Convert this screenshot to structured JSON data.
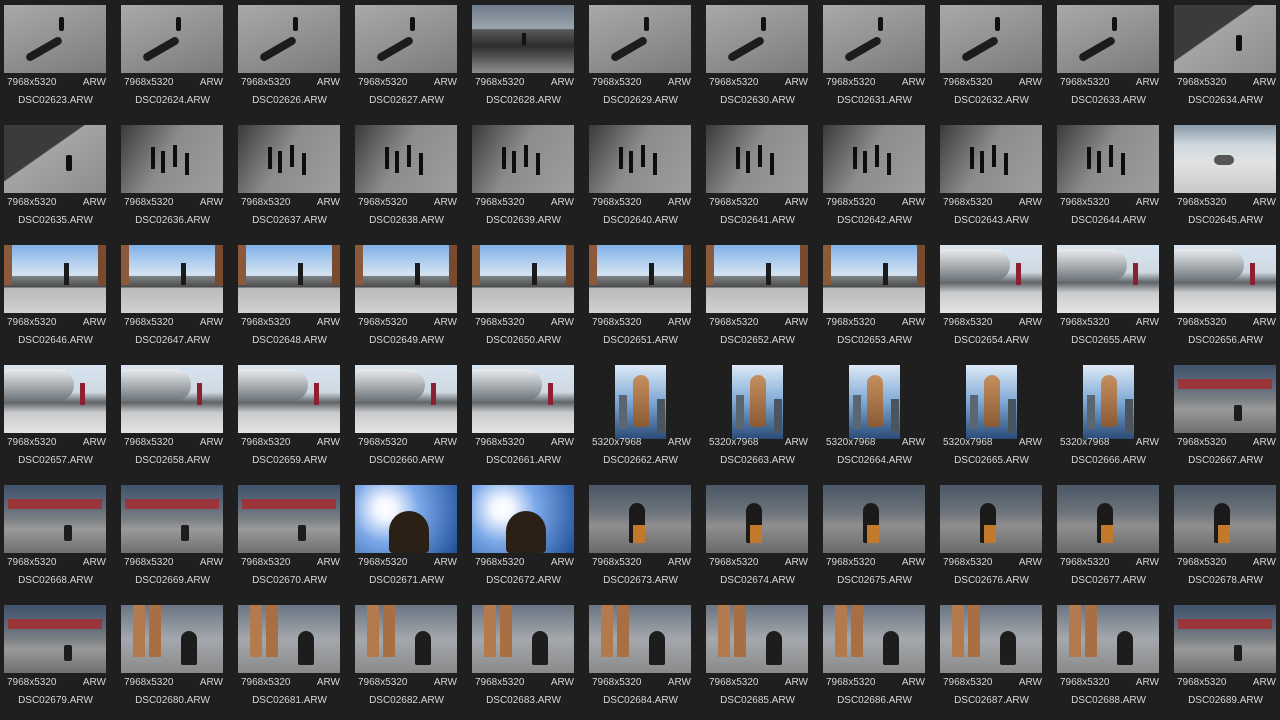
{
  "gallery": {
    "columns": 11,
    "items": [
      {
        "dims": "7968x5320",
        "format": "ARW",
        "name": "DSC02623.ARW",
        "scene": "shadow",
        "orientation": "landscape"
      },
      {
        "dims": "7968x5320",
        "format": "ARW",
        "name": "DSC02624.ARW",
        "scene": "shadow",
        "orientation": "landscape"
      },
      {
        "dims": "7968x5320",
        "format": "ARW",
        "name": "DSC02626.ARW",
        "scene": "shadow",
        "orientation": "landscape"
      },
      {
        "dims": "7968x5320",
        "format": "ARW",
        "name": "DSC02627.ARW",
        "scene": "shadow",
        "orientation": "landscape"
      },
      {
        "dims": "7968x5320",
        "format": "ARW",
        "name": "DSC02628.ARW",
        "scene": "plaza",
        "orientation": "landscape"
      },
      {
        "dims": "7968x5320",
        "format": "ARW",
        "name": "DSC02629.ARW",
        "scene": "shadow",
        "orientation": "landscape"
      },
      {
        "dims": "7968x5320",
        "format": "ARW",
        "name": "DSC02630.ARW",
        "scene": "shadow",
        "orientation": "landscape"
      },
      {
        "dims": "7968x5320",
        "format": "ARW",
        "name": "DSC02631.ARW",
        "scene": "shadow",
        "orientation": "landscape"
      },
      {
        "dims": "7968x5320",
        "format": "ARW",
        "name": "DSC02632.ARW",
        "scene": "shadow",
        "orientation": "landscape"
      },
      {
        "dims": "7968x5320",
        "format": "ARW",
        "name": "DSC02633.ARW",
        "scene": "shadow",
        "orientation": "landscape"
      },
      {
        "dims": "7968x5320",
        "format": "ARW",
        "name": "DSC02634.ARW",
        "scene": "diag",
        "orientation": "landscape"
      },
      {
        "dims": "7968x5320",
        "format": "ARW",
        "name": "DSC02635.ARW",
        "scene": "diag",
        "orientation": "landscape"
      },
      {
        "dims": "7968x5320",
        "format": "ARW",
        "name": "DSC02636.ARW",
        "scene": "crowd",
        "orientation": "landscape"
      },
      {
        "dims": "7968x5320",
        "format": "ARW",
        "name": "DSC02637.ARW",
        "scene": "crowd",
        "orientation": "landscape"
      },
      {
        "dims": "7968x5320",
        "format": "ARW",
        "name": "DSC02638.ARW",
        "scene": "crowd",
        "orientation": "landscape"
      },
      {
        "dims": "7968x5320",
        "format": "ARW",
        "name": "DSC02639.ARW",
        "scene": "crowd",
        "orientation": "landscape"
      },
      {
        "dims": "7968x5320",
        "format": "ARW",
        "name": "DSC02640.ARW",
        "scene": "crowd",
        "orientation": "landscape"
      },
      {
        "dims": "7968x5320",
        "format": "ARW",
        "name": "DSC02641.ARW",
        "scene": "crowd",
        "orientation": "landscape"
      },
      {
        "dims": "7968x5320",
        "format": "ARW",
        "name": "DSC02642.ARW",
        "scene": "crowd",
        "orientation": "landscape"
      },
      {
        "dims": "7968x5320",
        "format": "ARW",
        "name": "DSC02643.ARW",
        "scene": "crowd",
        "orientation": "landscape"
      },
      {
        "dims": "7968x5320",
        "format": "ARW",
        "name": "DSC02644.ARW",
        "scene": "crowd",
        "orientation": "landscape"
      },
      {
        "dims": "7968x5320",
        "format": "ARW",
        "name": "DSC02645.ARW",
        "scene": "bright",
        "orientation": "landscape"
      },
      {
        "dims": "7968x5320",
        "format": "ARW",
        "name": "DSC02646.ARW",
        "scene": "skyline",
        "orientation": "landscape"
      },
      {
        "dims": "7968x5320",
        "format": "ARW",
        "name": "DSC02647.ARW",
        "scene": "skyline",
        "orientation": "landscape"
      },
      {
        "dims": "7968x5320",
        "format": "ARW",
        "name": "DSC02648.ARW",
        "scene": "skyline",
        "orientation": "landscape"
      },
      {
        "dims": "7968x5320",
        "format": "ARW",
        "name": "DSC02649.ARW",
        "scene": "skyline",
        "orientation": "landscape"
      },
      {
        "dims": "7968x5320",
        "format": "ARW",
        "name": "DSC02650.ARW",
        "scene": "skyline",
        "orientation": "landscape"
      },
      {
        "dims": "7968x5320",
        "format": "ARW",
        "name": "DSC02651.ARW",
        "scene": "skyline",
        "orientation": "landscape"
      },
      {
        "dims": "7968x5320",
        "format": "ARW",
        "name": "DSC02652.ARW",
        "scene": "skyline",
        "orientation": "landscape"
      },
      {
        "dims": "7968x5320",
        "format": "ARW",
        "name": "DSC02653.ARW",
        "scene": "skyline",
        "orientation": "landscape"
      },
      {
        "dims": "7968x5320",
        "format": "ARW",
        "name": "DSC02654.ARW",
        "scene": "arch",
        "orientation": "landscape"
      },
      {
        "dims": "7968x5320",
        "format": "ARW",
        "name": "DSC02655.ARW",
        "scene": "arch",
        "orientation": "landscape"
      },
      {
        "dims": "7968x5320",
        "format": "ARW",
        "name": "DSC02656.ARW",
        "scene": "arch",
        "orientation": "landscape"
      },
      {
        "dims": "7968x5320",
        "format": "ARW",
        "name": "DSC02657.ARW",
        "scene": "arch",
        "orientation": "landscape"
      },
      {
        "dims": "7968x5320",
        "format": "ARW",
        "name": "DSC02658.ARW",
        "scene": "arch",
        "orientation": "landscape"
      },
      {
        "dims": "7968x5320",
        "format": "ARW",
        "name": "DSC02659.ARW",
        "scene": "arch",
        "orientation": "landscape"
      },
      {
        "dims": "7968x5320",
        "format": "ARW",
        "name": "DSC02660.ARW",
        "scene": "arch",
        "orientation": "landscape"
      },
      {
        "dims": "7968x5320",
        "format": "ARW",
        "name": "DSC02661.ARW",
        "scene": "arch",
        "orientation": "landscape"
      },
      {
        "dims": "5320x7968",
        "format": "ARW",
        "name": "DSC02662.ARW",
        "scene": "statue",
        "orientation": "portrait"
      },
      {
        "dims": "5320x7968",
        "format": "ARW",
        "name": "DSC02663.ARW",
        "scene": "statue",
        "orientation": "portrait"
      },
      {
        "dims": "5320x7968",
        "format": "ARW",
        "name": "DSC02664.ARW",
        "scene": "statue",
        "orientation": "portrait"
      },
      {
        "dims": "5320x7968",
        "format": "ARW",
        "name": "DSC02665.ARW",
        "scene": "statue",
        "orientation": "portrait"
      },
      {
        "dims": "5320x7968",
        "format": "ARW",
        "name": "DSC02666.ARW",
        "scene": "statue",
        "orientation": "portrait"
      },
      {
        "dims": "7968x5320",
        "format": "ARW",
        "name": "DSC02667.ARW",
        "scene": "street",
        "orientation": "landscape"
      },
      {
        "dims": "7968x5320",
        "format": "ARW",
        "name": "DSC02668.ARW",
        "scene": "street",
        "orientation": "landscape"
      },
      {
        "dims": "7968x5320",
        "format": "ARW",
        "name": "DSC02669.ARW",
        "scene": "street",
        "orientation": "landscape"
      },
      {
        "dims": "7968x5320",
        "format": "ARW",
        "name": "DSC02670.ARW",
        "scene": "street",
        "orientation": "landscape"
      },
      {
        "dims": "7968x5320",
        "format": "ARW",
        "name": "DSC02671.ARW",
        "scene": "sun",
        "orientation": "landscape"
      },
      {
        "dims": "7968x5320",
        "format": "ARW",
        "name": "DSC02672.ARW",
        "scene": "sun",
        "orientation": "landscape"
      },
      {
        "dims": "7968x5320",
        "format": "ARW",
        "name": "DSC02673.ARW",
        "scene": "woman",
        "orientation": "landscape"
      },
      {
        "dims": "7968x5320",
        "format": "ARW",
        "name": "DSC02674.ARW",
        "scene": "woman",
        "orientation": "landscape"
      },
      {
        "dims": "7968x5320",
        "format": "ARW",
        "name": "DSC02675.ARW",
        "scene": "woman",
        "orientation": "landscape"
      },
      {
        "dims": "7968x5320",
        "format": "ARW",
        "name": "DSC02676.ARW",
        "scene": "woman",
        "orientation": "landscape"
      },
      {
        "dims": "7968x5320",
        "format": "ARW",
        "name": "DSC02677.ARW",
        "scene": "woman",
        "orientation": "landscape"
      },
      {
        "dims": "7968x5320",
        "format": "ARW",
        "name": "DSC02678.ARW",
        "scene": "woman",
        "orientation": "landscape"
      },
      {
        "dims": "7968x5320",
        "format": "ARW",
        "name": "DSC02679.ARW",
        "scene": "street",
        "orientation": "landscape"
      },
      {
        "dims": "7968x5320",
        "format": "ARW",
        "name": "DSC02680.ARW",
        "scene": "legs",
        "orientation": "landscape"
      },
      {
        "dims": "7968x5320",
        "format": "ARW",
        "name": "DSC02681.ARW",
        "scene": "legs",
        "orientation": "landscape"
      },
      {
        "dims": "7968x5320",
        "format": "ARW",
        "name": "DSC02682.ARW",
        "scene": "legs",
        "orientation": "landscape"
      },
      {
        "dims": "7968x5320",
        "format": "ARW",
        "name": "DSC02683.ARW",
        "scene": "legs",
        "orientation": "landscape"
      },
      {
        "dims": "7968x5320",
        "format": "ARW",
        "name": "DSC02684.ARW",
        "scene": "legs",
        "orientation": "landscape"
      },
      {
        "dims": "7968x5320",
        "format": "ARW",
        "name": "DSC02685.ARW",
        "scene": "legs",
        "orientation": "landscape"
      },
      {
        "dims": "7968x5320",
        "format": "ARW",
        "name": "DSC02686.ARW",
        "scene": "legs",
        "orientation": "landscape"
      },
      {
        "dims": "7968x5320",
        "format": "ARW",
        "name": "DSC02687.ARW",
        "scene": "legs",
        "orientation": "landscape"
      },
      {
        "dims": "7968x5320",
        "format": "ARW",
        "name": "DSC02688.ARW",
        "scene": "legs",
        "orientation": "landscape"
      },
      {
        "dims": "7968x5320",
        "format": "ARW",
        "name": "DSC02689.ARW",
        "scene": "street",
        "orientation": "landscape"
      }
    ]
  }
}
